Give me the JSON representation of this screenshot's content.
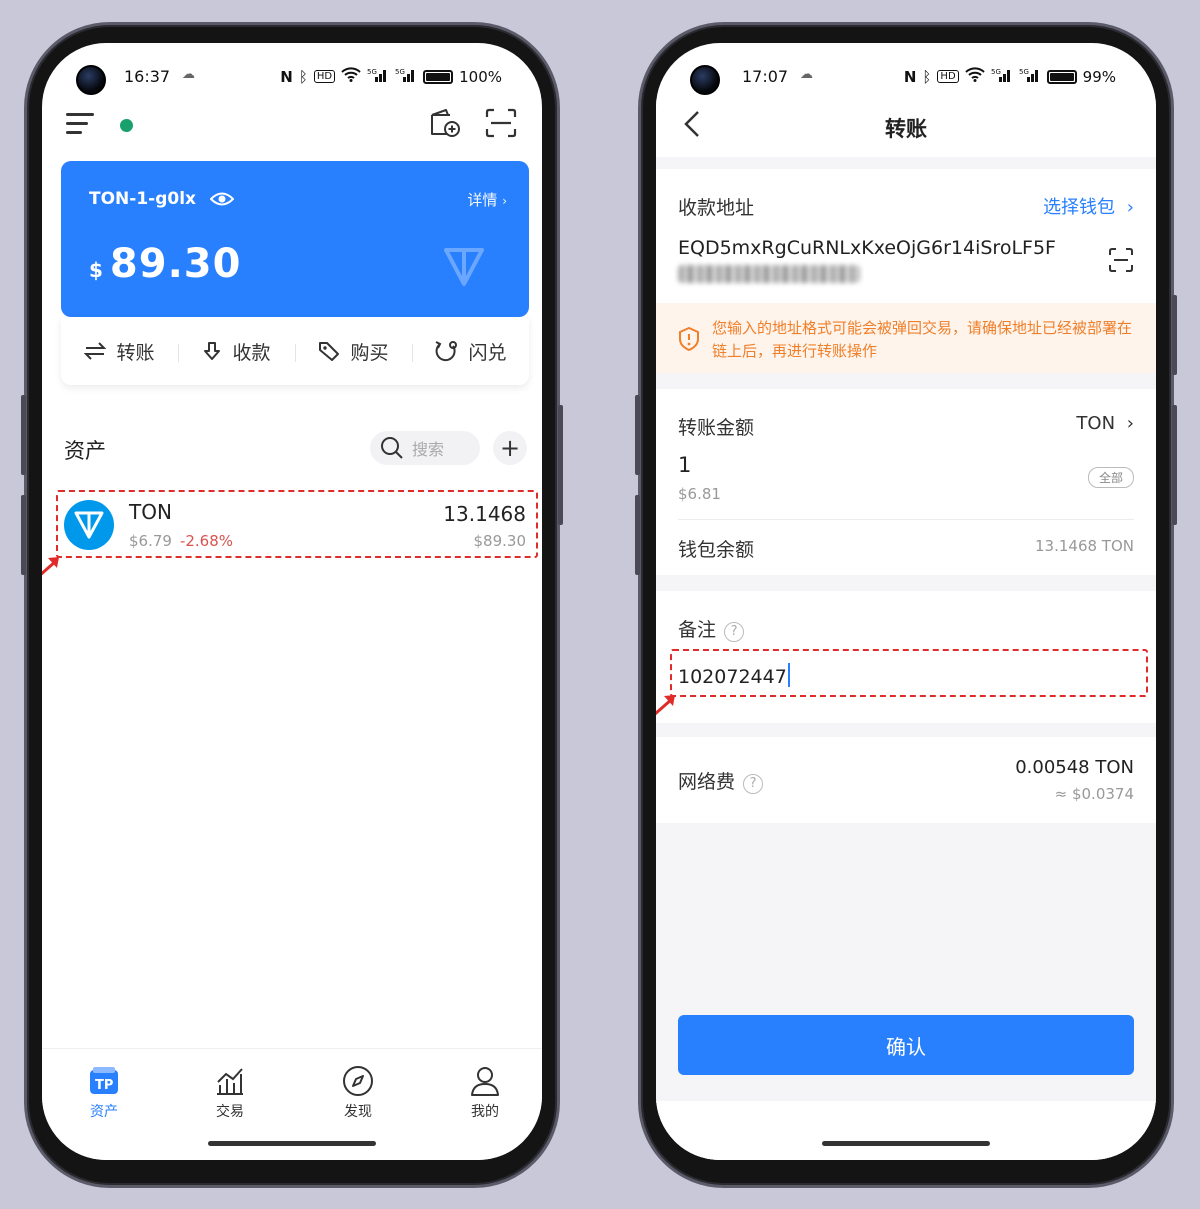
{
  "colors": {
    "accent": "#2980fe",
    "warning": "#f07f2a",
    "negative": "#d9534f",
    "online": "#1aa06d",
    "highlight": "#e02b2b"
  },
  "left_phone": {
    "status_bar": {
      "time": "16:37",
      "battery": "100%",
      "icons": [
        "nfc-icon",
        "bluetooth-icon",
        "hd-icon",
        "wifi-icon",
        "signal-5g-icon",
        "signal-5g-icon"
      ]
    },
    "wallet_card": {
      "name": "TON-1-g0lx",
      "details_label": "详情",
      "currency_symbol": "$",
      "balance": "89.30"
    },
    "actions": [
      {
        "label": "转账",
        "icon": "transfer-icon"
      },
      {
        "label": "收款",
        "icon": "receive-icon"
      },
      {
        "label": "购买",
        "icon": "tag-icon"
      },
      {
        "label": "闪兑",
        "icon": "swap-icon"
      }
    ],
    "assets": {
      "title": "资产",
      "search_placeholder": "搜索",
      "items": [
        {
          "name": "TON",
          "price": "$6.79",
          "change": "-2.68%",
          "quantity": "13.1468",
          "value": "$89.30"
        }
      ]
    },
    "bottom_nav": [
      {
        "label": "资产",
        "active": true
      },
      {
        "label": "交易"
      },
      {
        "label": "发现"
      },
      {
        "label": "我的"
      }
    ]
  },
  "right_phone": {
    "status_bar": {
      "time": "17:07",
      "battery": "99%"
    },
    "title": "转账",
    "recipient": {
      "label": "收款地址",
      "select_wallet": "选择钱包",
      "address_line1": "EQD5mxRgCuRNLxKxeOjG6r14iSroLF5F"
    },
    "warning": "您输入的地址格式可能会被弹回交易，请确保地址已经被部署在链上后，再进行转账操作",
    "amount": {
      "label": "转账金额",
      "token": "TON",
      "value": "1",
      "fiat": "$6.81",
      "all_label": "全部"
    },
    "balance": {
      "label": "钱包余额",
      "value": "13.1468 TON"
    },
    "memo": {
      "label": "备注",
      "value": "102072447"
    },
    "fee": {
      "label": "网络费",
      "value": "0.00548 TON",
      "fiat": "≈ $0.0374"
    },
    "confirm_label": "确认"
  }
}
